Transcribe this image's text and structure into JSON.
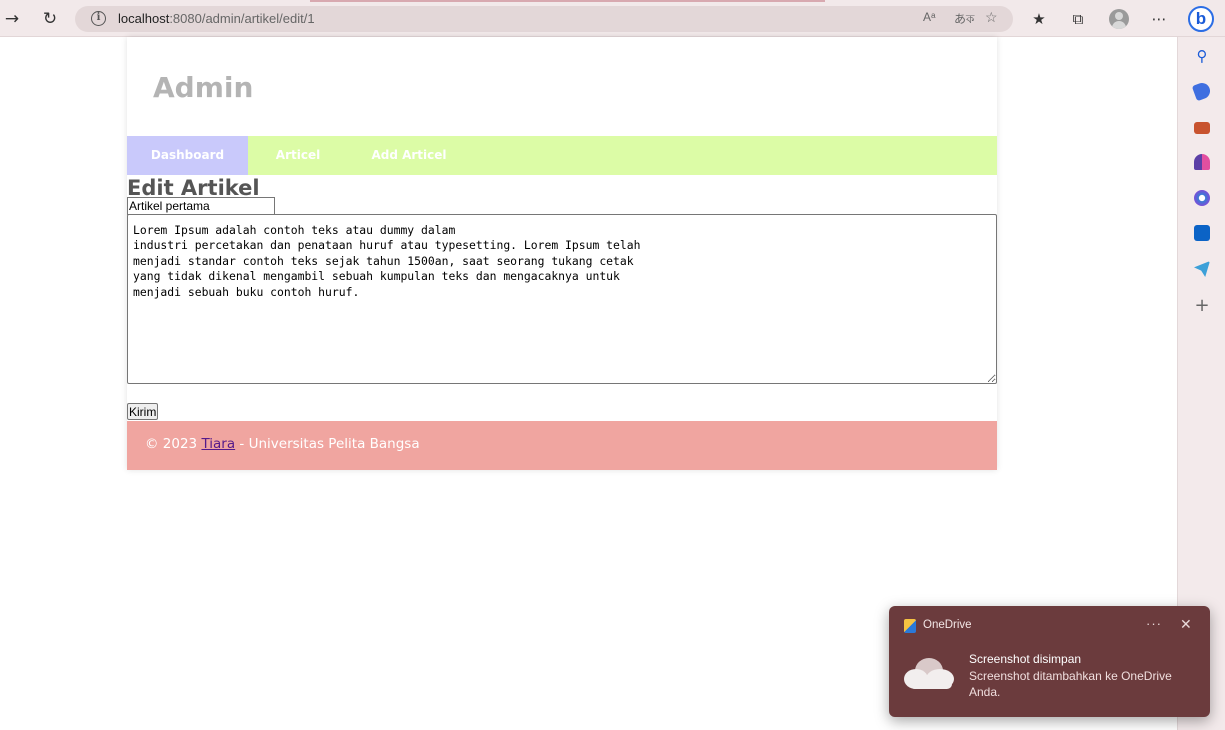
{
  "browser": {
    "url_host": "localhost",
    "url_path": ":8080/admin/artikel/edit/1",
    "read_aloud_icon": "Aᵃ",
    "translate_icon": "あক"
  },
  "site": {
    "title": "Admin",
    "menu": [
      {
        "label": "Dashboard"
      },
      {
        "label": "Articel"
      },
      {
        "label": "Add Articel"
      }
    ]
  },
  "form": {
    "heading": "Edit Artikel",
    "title_value": "Artikel pertama",
    "body_value": "Lorem Ipsum adalah contoh teks atau dummy dalam\nindustri percetakan dan penataan huruf atau typesetting. Lorem Ipsum telah\nmenjadi standar contoh teks sejak tahun 1500an, saat seorang tukang cetak\nyang tidak dikenal mengambil sebuah kumpulan teks dan mengacaknya untuk\nmenjadi sebuah buku contoh huruf.",
    "submit_label": "Kirim"
  },
  "footer": {
    "prefix": "© 2023 ",
    "author": "Tiara",
    "suffix": " - Universitas Pelita Bangsa"
  },
  "toast": {
    "app_name": "OneDrive",
    "more_label": "···",
    "close_label": "✕",
    "title": "Screenshot disimpan",
    "body": "Screenshot ditambahkan ke OneDrive Anda."
  },
  "icons": {
    "back": "arrow-right-icon",
    "refresh": "refresh-icon",
    "favorites": "favorites-icon",
    "collections": "collections-icon",
    "more": "more-icon",
    "sidebar": [
      "search-icon",
      "shopping-tag-icon",
      "tools-icon",
      "games-icon",
      "office-icon",
      "outlook-icon",
      "send-icon",
      "add-icon"
    ]
  },
  "colors": {
    "menu_bg": "#dcfca6",
    "menu_active_bg": "#c9c9fb",
    "footer_bg": "#f0a5a0",
    "toast_bg": "#6b3b3d"
  }
}
